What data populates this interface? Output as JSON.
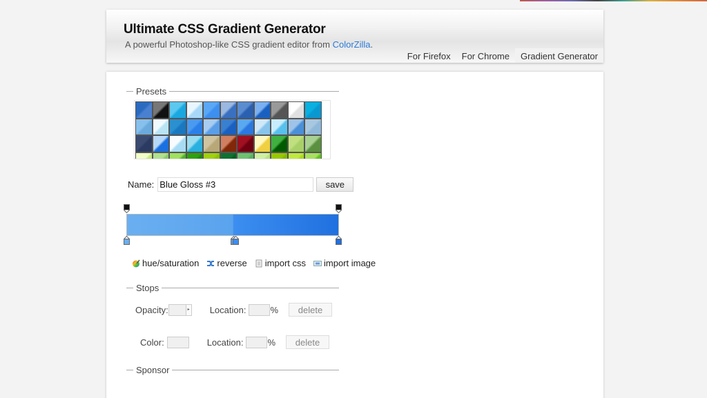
{
  "header": {
    "title": "Ultimate CSS Gradient Generator",
    "subtitle_prefix": "A powerful Photoshop-like CSS gradient editor from ",
    "subtitle_link": "ColorZilla",
    "subtitle_suffix": ".",
    "nav": [
      {
        "label": "For Firefox",
        "active": false
      },
      {
        "label": "For Chrome",
        "active": false
      },
      {
        "label": "Gradient Generator",
        "active": true
      }
    ]
  },
  "presets": {
    "legend": "Presets",
    "swatches": [
      [
        "#2a6bc0",
        "#4a80d0"
      ],
      [
        "#777",
        "#111"
      ],
      [
        "#5cc8f0",
        "#1aa8e0"
      ],
      [
        "#e8f6ff",
        "#a8d8f8"
      ],
      [
        "#5aa8f5",
        "#3d8ff0"
      ],
      [
        "#9ab8e0",
        "#3a70c0"
      ],
      [
        "#5a8cd0",
        "#2a60b0"
      ],
      [
        "#7ab0f0",
        "#1a60c0"
      ],
      [
        "#999",
        "#555"
      ],
      [
        "#fff",
        "#e0e0e0"
      ],
      [
        "#0ab0e0",
        "#0a98d0"
      ],
      [
        "#88c0ec",
        "#6aaadc"
      ],
      [
        "#f0fbff",
        "#b8e4f4"
      ],
      [
        "#2a90d0",
        "#1a78c0"
      ],
      [
        "#4a9af0",
        "#2a80e8"
      ],
      [
        "#a8cdf0",
        "#5a9ee8"
      ],
      [
        "#3a80d0",
        "#1a60c0"
      ],
      [
        "#5aa8f0",
        "#2a78e0"
      ],
      [
        "#d0e8f8",
        "#88c4ec"
      ],
      [
        "#c8ecfc",
        "#58c0ec"
      ],
      [
        "#a0c4e8",
        "#4a90d8"
      ],
      [
        "#a8c8e0",
        "#90b8d8"
      ],
      [
        "#3a4a70",
        "#2a3a60"
      ],
      [
        "#b8d8f8",
        "#1a70e0"
      ],
      [
        "#f8fcff",
        "#a8dcf4"
      ],
      [
        "#9adcf0",
        "#28b0e0"
      ],
      [
        "#d0c4a0",
        "#b8a878"
      ],
      [
        "#d08060",
        "#802808"
      ],
      [
        "#a01020",
        "#700010"
      ],
      [
        "#fff8c0",
        "#f0d040"
      ],
      [
        "#40b040",
        "#005a00"
      ],
      [
        "#c0e080",
        "#a8d068"
      ],
      [
        "#a8d090",
        "#5a9040"
      ],
      [
        "#f0ffc8",
        "#c8e880"
      ],
      [
        "#b0e090",
        "#88c868"
      ],
      [
        "#a0e060",
        "#50b030"
      ],
      [
        "#30a010",
        "#208808"
      ],
      [
        "#a0d010",
        "#88c000"
      ],
      [
        "#107030",
        "#006020"
      ],
      [
        "#70c070",
        "#58b060"
      ],
      [
        "#d0f0a0",
        "#b8e080"
      ],
      [
        "#98c800",
        "#80b800"
      ],
      [
        "#c0e840",
        "#a8d820"
      ],
      [
        "#a8e060",
        "#60c020"
      ]
    ]
  },
  "name_field": {
    "label": "Name:",
    "value": "Blue Gloss #3"
  },
  "save_button": "save",
  "gradient": {
    "stops": [
      {
        "color": "#6aaff0",
        "location_percent": 0
      },
      {
        "color": "#5aa3ee",
        "location_percent": 50
      },
      {
        "color": "#3c8ef0",
        "location_percent": 51
      },
      {
        "color": "#2070e0",
        "location_percent": 100
      }
    ],
    "opacity_stops": [
      {
        "opacity_percent": 100,
        "location_percent": 0
      },
      {
        "opacity_percent": 100,
        "location_percent": 100
      }
    ]
  },
  "actions": [
    {
      "label": "hue/saturation",
      "icon": "color-wheel-icon"
    },
    {
      "label": "reverse",
      "icon": "reverse-arrows-icon"
    },
    {
      "label": "import css",
      "icon": "document-icon"
    },
    {
      "label": "import image",
      "icon": "image-icon"
    }
  ],
  "stops_panel": {
    "legend": "Stops",
    "opacity_label": "Opacity:",
    "color_label": "Color:",
    "location_label": "Location:",
    "percent": "%",
    "delete_label": "delete"
  },
  "sponsor": {
    "legend": "Sponsor"
  }
}
